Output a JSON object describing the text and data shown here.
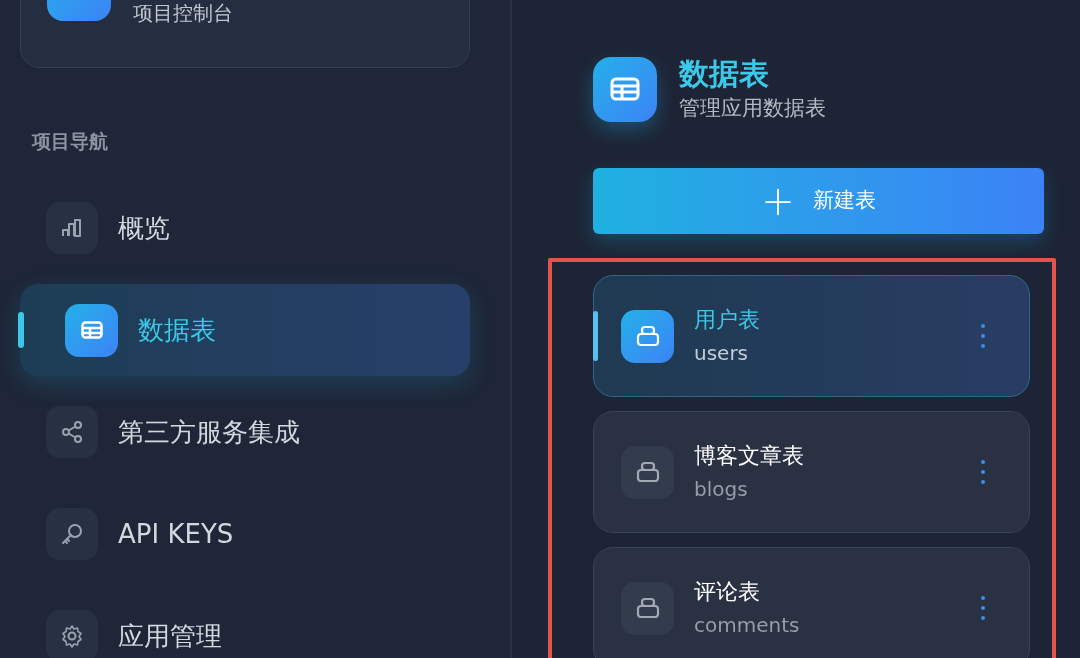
{
  "project_card": {
    "subtitle": "项目控制台"
  },
  "sidebar": {
    "section_title": "项目导航",
    "items": [
      {
        "kind": "chart",
        "label": "概览",
        "selected": false
      },
      {
        "kind": "table",
        "label": "数据表",
        "selected": true
      },
      {
        "kind": "share",
        "label": "第三方服务集成",
        "selected": false
      },
      {
        "kind": "key",
        "label": "API KEYS",
        "selected": false
      },
      {
        "kind": "gear",
        "label": "应用管理",
        "selected": false
      }
    ]
  },
  "header": {
    "title": "数据表",
    "subtitle": "管理应用数据表"
  },
  "new_button": {
    "icon": "+",
    "label": "新建表"
  },
  "tables": [
    {
      "name": "用户表",
      "id": "users",
      "selected": true
    },
    {
      "name": "博客文章表",
      "id": "blogs",
      "selected": false
    },
    {
      "name": "评论表",
      "id": "comments",
      "selected": false
    }
  ]
}
